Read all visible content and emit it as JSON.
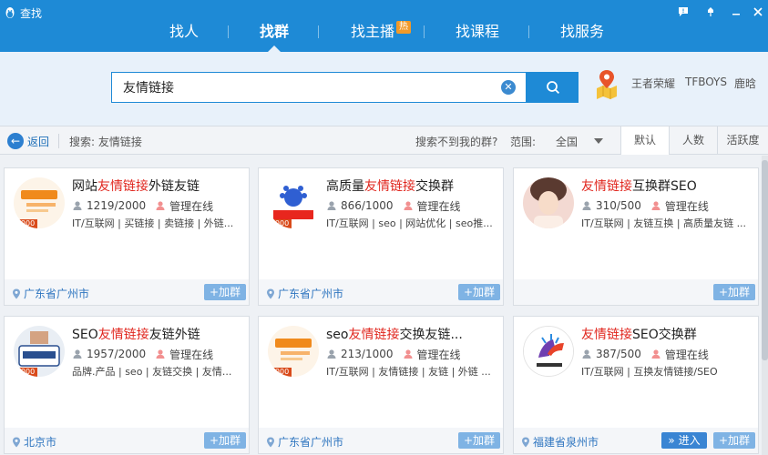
{
  "app": {
    "title": "查找"
  },
  "colors": {
    "brand": "#1e8ad6",
    "highlight": "#e0261e",
    "location": "#2f76c0",
    "hot_badge": "#f29a29"
  },
  "nav": {
    "tabs": [
      {
        "label": "找人"
      },
      {
        "label": "找群"
      },
      {
        "label": "找主播",
        "badge": "热"
      },
      {
        "label": "找课程"
      },
      {
        "label": "找服务"
      }
    ],
    "active_tab": "找群"
  },
  "search": {
    "value": "友情链接",
    "hot_keywords": [
      "王者荣耀",
      "TFBOYS",
      "鹿晗"
    ]
  },
  "filter": {
    "back_label": "返回",
    "search_label": "搜索: 友情链接",
    "not_found_label": "搜索不到我的群?",
    "scope_label": "范围:",
    "scope_value": "全国",
    "sort_tabs": [
      "默认",
      "人数",
      "活跃度"
    ],
    "active_sort": "默认"
  },
  "cards": [
    {
      "title_pre": "网站",
      "title_hl": "友情链接",
      "title_post": "外链友链",
      "members": "1219/2000",
      "admin": "管理在线",
      "tags": "IT/互联网 | 买链接 | 卖链接 | 外链...",
      "location": "广东省广州市",
      "join": "+加群",
      "avatar_badge": "2000",
      "avatar": "orange-logo"
    },
    {
      "title_pre": "高质量",
      "title_hl": "友情链接",
      "title_post": "交换群",
      "members": "866/1000",
      "admin": "管理在线",
      "tags": "IT/互联网 | seo | 网站优化 | seo推...",
      "location": "广东省广州市",
      "join": "+加群",
      "avatar_badge": "1000",
      "avatar": "baidu-logo"
    },
    {
      "title_pre": "",
      "title_hl": "友情链接",
      "title_post": "互换群SEO",
      "members": "310/500",
      "admin": "管理在线",
      "tags": "IT/互联网 | 友链互换 | 高质量友链 ...",
      "location": "",
      "join": "+加群",
      "avatar_badge": "",
      "avatar": "portrait"
    },
    {
      "title_pre": "SEO",
      "title_hl": "友情链接",
      "title_post": "友链外链",
      "members": "1957/2000",
      "admin": "管理在线",
      "tags": "品牌.产品 | seo | 友链交换 | 友情...",
      "location": "北京市",
      "join": "+加群",
      "avatar_badge": "2000",
      "avatar": "seo-logo"
    },
    {
      "title_pre": "seo",
      "title_hl": "友情链接",
      "title_post": "交换友链...",
      "members": "213/1000",
      "admin": "管理在线",
      "tags": "IT/互联网 | 友情链接 | 友链 | 外链 ...",
      "location": "广东省广州市",
      "join": "+加群",
      "avatar_badge": "1000",
      "avatar": "orange-logo"
    },
    {
      "title_pre": "",
      "title_hl": "友情链接",
      "title_post": "SEO交换群",
      "members": "387/500",
      "admin": "管理在线",
      "tags": "IT/互联网 | 互换友情链接/SEO",
      "location": "福建省泉州市",
      "join": "+加群",
      "enter": "» 进入",
      "avatar_badge": "",
      "avatar": "horse-logo"
    }
  ]
}
